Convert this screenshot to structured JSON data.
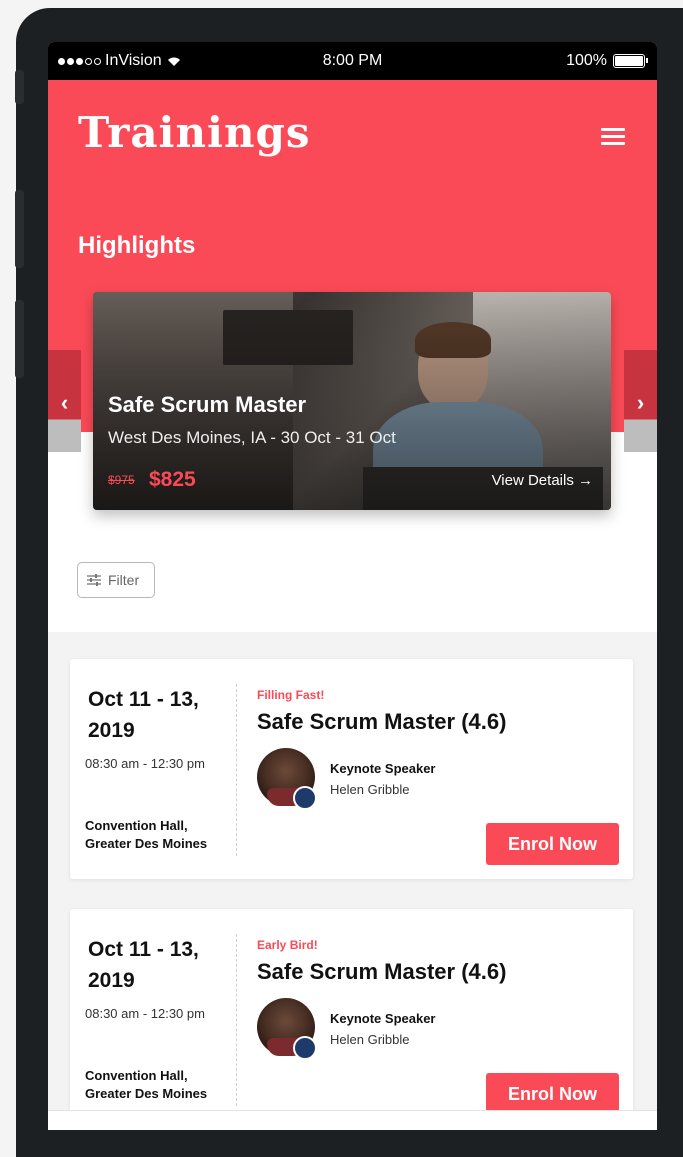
{
  "status_bar": {
    "carrier": "InVision",
    "time": "8:00 PM",
    "battery": "100%"
  },
  "header": {
    "brand": "Trainings",
    "section_title": "Highlights"
  },
  "highlight": {
    "title": "Safe Scrum Master",
    "location_dates": "West Des Moines, IA -  30 Oct - 31 Oct",
    "old_price": "$975",
    "new_price": "$825",
    "view_details": "View Details →",
    "prev_chevron": "‹",
    "next_chevron": "›"
  },
  "filter": {
    "label": "Filter"
  },
  "events": [
    {
      "date": "Oct 11 - 13, 2019",
      "time": "08:30 am - 12:30 pm",
      "venue_line1": "Convention Hall,",
      "venue_line2": "Greater Des Moines",
      "tag": "Filling Fast!",
      "title": "Safe Scrum Master (4.6)",
      "speaker_role": "Keynote Speaker",
      "speaker_name": "Helen Gribble",
      "cta": "Enrol Now"
    },
    {
      "date": "Oct 11 - 13, 2019",
      "time": "08:30 am - 12:30 pm",
      "venue_line1": "Convention Hall,",
      "venue_line2": "Greater Des Moines",
      "tag": "Early Bird!",
      "title": "Safe Scrum Master (4.6)",
      "speaker_role": "Keynote Speaker",
      "speaker_name": "Helen Gribble",
      "cta": "Enrol Now"
    }
  ],
  "colors": {
    "accent": "#fb4a57",
    "dark_accent": "#c7343f",
    "phone_body": "#1d2023"
  }
}
